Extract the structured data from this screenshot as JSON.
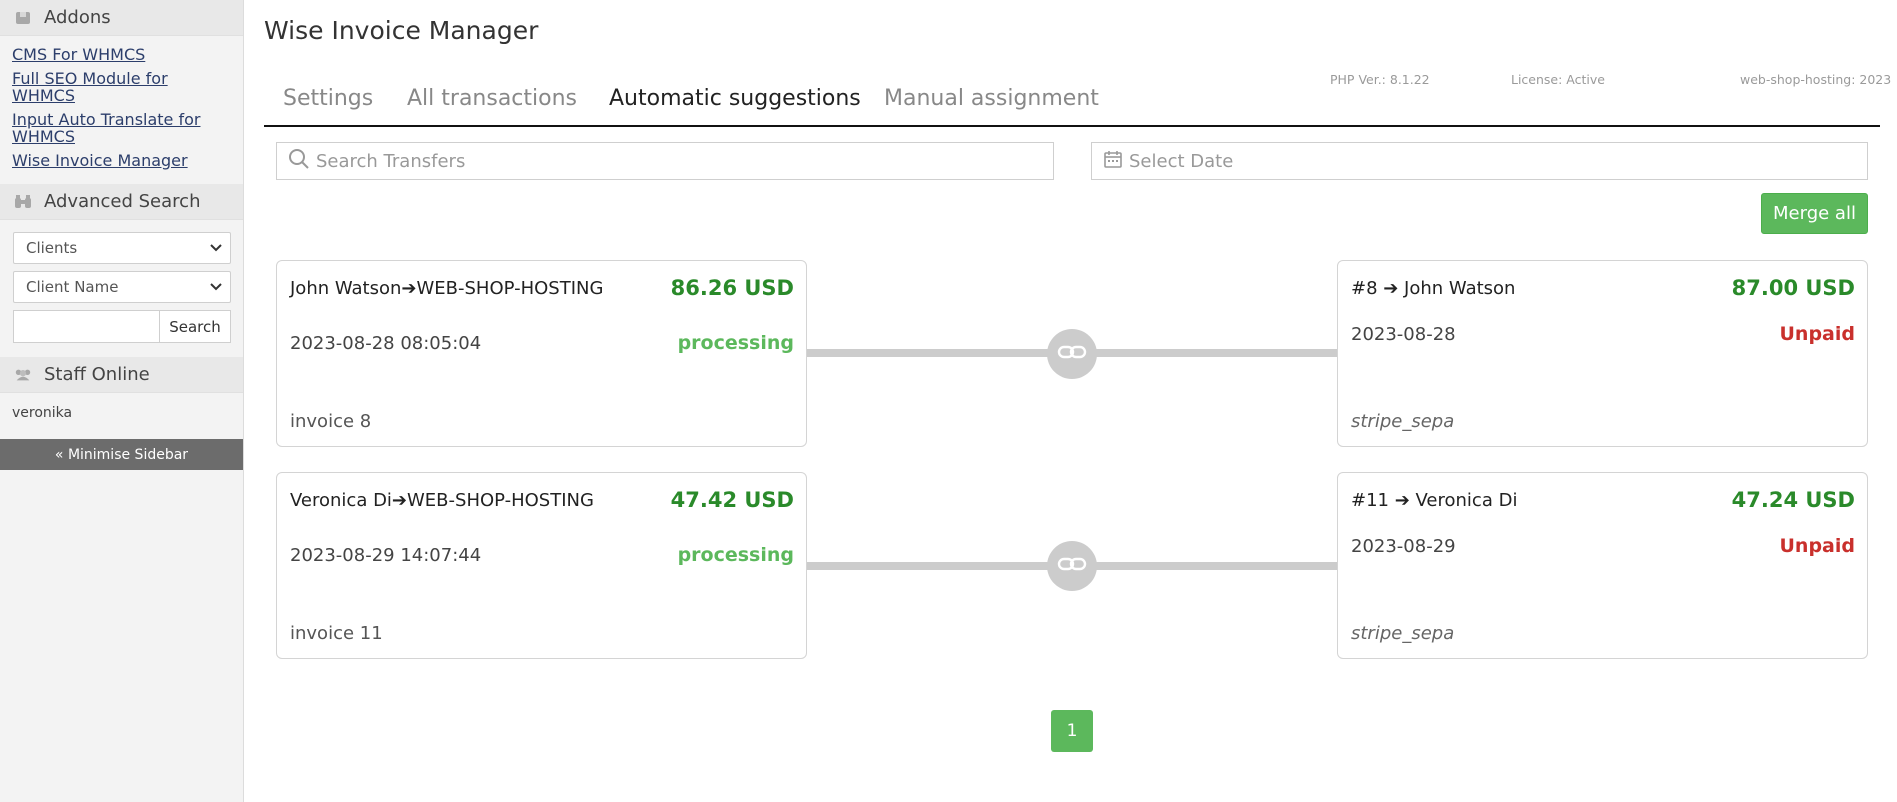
{
  "sidebar": {
    "addons_title": "Addons",
    "addons_links": [
      "CMS For WHMCS",
      "Full SEO Module for WHMCS",
      "Input Auto Translate for WHMCS",
      "Wise Invoice Manager"
    ],
    "advanced_search_title": "Advanced Search",
    "search_type_select": "Clients",
    "search_field_select": "Client Name",
    "search_button": "Search",
    "staff_online_title": "Staff Online",
    "staff_online_users": [
      "veronika"
    ],
    "minimise_label": "« Minimise Sidebar"
  },
  "main": {
    "title": "Wise Invoice Manager",
    "tabs": [
      {
        "label": "Settings",
        "active": false
      },
      {
        "label": "All transactions",
        "active": false
      },
      {
        "label": "Automatic suggestions",
        "active": true
      },
      {
        "label": "Manual assignment",
        "active": false
      }
    ],
    "meta": {
      "php_version": "PHP Ver.: 8.1.22",
      "license": "License: Active",
      "site": "web-shop-hosting: 2023"
    },
    "search_placeholder": "Search Transfers",
    "date_placeholder": "Select Date",
    "merge_all_label": "Merge all",
    "suggestions": [
      {
        "transaction": {
          "title": "John Watson➔WEB-SHOP-HOSTING",
          "amount": "86.26 USD",
          "datetime": "2023-08-28 08:05:04",
          "status": "processing",
          "note": "invoice 8"
        },
        "invoice": {
          "title": "#8 ➔ John Watson",
          "amount": "87.00 USD",
          "date": "2023-08-28",
          "status": "Unpaid",
          "method": "stripe_sepa"
        }
      },
      {
        "transaction": {
          "title": "Veronica Di➔WEB-SHOP-HOSTING",
          "amount": "47.42 USD",
          "datetime": "2023-08-29 14:07:44",
          "status": "processing",
          "note": "invoice 11"
        },
        "invoice": {
          "title": "#11 ➔ Veronica Di",
          "amount": "47.24 USD",
          "date": "2023-08-29",
          "status": "Unpaid",
          "method": "stripe_sepa"
        }
      }
    ],
    "pagination": {
      "current_page": "1"
    }
  },
  "colors": {
    "accent_green": "#5cb85c",
    "amount_green": "#2a8a2a",
    "unpaid_red": "#c9302c"
  },
  "icons": [
    "addons-box-icon",
    "binoculars-icon",
    "staff-users-icon",
    "search-icon",
    "calendar-icon",
    "chevron-down-icon",
    "link-chain-icon"
  ]
}
